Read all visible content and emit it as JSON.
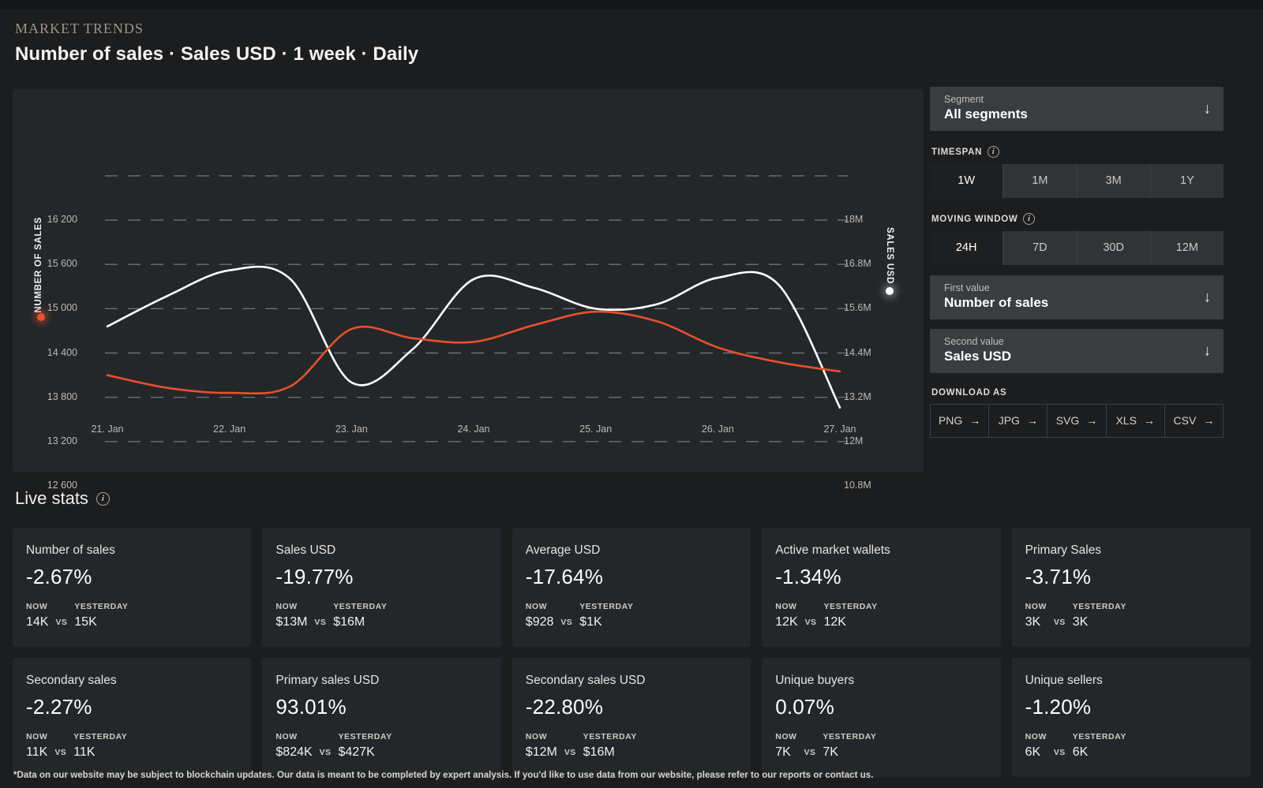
{
  "header": {
    "eyebrow": "MARKET TRENDS",
    "title": "Number of sales · Sales USD · 1 week · Daily"
  },
  "chart_data": {
    "type": "line",
    "title": "Number of sales · Sales USD · 1 week · Daily",
    "xlabel": "",
    "ylabel": "NUMBER OF SALES",
    "y2label": "SALES USD",
    "grid": true,
    "grid_style": "dashed",
    "legend": "none",
    "x_tick_labels": [
      "21. Jan",
      "22. Jan",
      "23. Jan",
      "24. Jan",
      "25. Jan",
      "26. Jan",
      "27. Jan"
    ],
    "y_left_ticks": [
      "12 600",
      "13 200",
      "13 800",
      "14 400",
      "15 000",
      "15 600",
      "16 200"
    ],
    "y_left_values": [
      12600,
      13200,
      13800,
      14400,
      15000,
      15600,
      16200
    ],
    "ylim": [
      12300,
      16500
    ],
    "y_right_ticks": [
      "10.8M",
      "12M",
      "13.2M",
      "14.4M",
      "15.6M",
      "16.8M",
      "18M"
    ],
    "y_right_values": [
      10800000,
      12000000,
      13200000,
      14400000,
      15600000,
      16800000,
      18000000
    ],
    "y2lim": [
      10200000,
      18600000
    ],
    "series": [
      {
        "name": "Number of sales",
        "axis": "left",
        "color": "#ffffff",
        "marker_color": "#ffffff",
        "x": [
          "21. Jan",
          "21. Jan (pm)",
          "22. Jan",
          "22. Jan (pm)",
          "23. Jan",
          "23. Jan (pm)",
          "24. Jan",
          "24. Jan (pm)",
          "25. Jan",
          "25. Jan (pm)",
          "26. Jan",
          "26. Jan (pm)",
          "27. Jan"
        ],
        "values": [
          14760,
          15180,
          15520,
          15400,
          14000,
          14450,
          15400,
          15280,
          15000,
          15060,
          15420,
          15320,
          13660
        ]
      },
      {
        "name": "Sales USD",
        "axis": "right",
        "color": "#e8502e",
        "marker_color": "#e8502e",
        "x": [
          "21. Jan",
          "21. Jan (pm)",
          "22. Jan",
          "22. Jan (pm)",
          "23. Jan",
          "23. Jan (pm)",
          "24. Jan",
          "24. Jan (pm)",
          "25. Jan",
          "25. Jan (pm)",
          "26. Jan",
          "26. Jan (pm)",
          "27. Jan"
        ],
        "values": [
          13800000,
          13450000,
          13320000,
          13500000,
          15050000,
          14800000,
          14700000,
          15160000,
          15520000,
          15260000,
          14550000,
          14150000,
          13900000
        ]
      }
    ]
  },
  "controls": {
    "segment": {
      "label": "Segment",
      "value": "All segments",
      "icon": "chevron-down-icon"
    },
    "timespan": {
      "label": "TIMESPAN",
      "info_icon": "info-icon",
      "options": [
        "1W",
        "1M",
        "3M",
        "1Y"
      ],
      "selected": "1W"
    },
    "moving_window": {
      "label": "MOVING WINDOW",
      "info_icon": "info-icon",
      "options": [
        "24H",
        "7D",
        "30D",
        "12M"
      ],
      "selected": "24H"
    },
    "first_value": {
      "label": "First value",
      "value": "Number of sales",
      "icon": "chevron-down-icon"
    },
    "second_value": {
      "label": "Second value",
      "value": "Sales USD",
      "icon": "chevron-down-icon"
    },
    "download": {
      "label": "DOWNLOAD AS",
      "options": [
        "PNG",
        "JPG",
        "SVG",
        "XLS",
        "CSV"
      ],
      "arrow_icon": "arrow-right-icon"
    }
  },
  "live_stats": {
    "heading": "Live stats",
    "info_icon": "info-icon",
    "now_caption": "NOW",
    "yesterday_caption": "YESTERDAY",
    "vs_caption": "VS",
    "cards": [
      {
        "name": "Number of sales",
        "pct": "-2.67%",
        "now": "14K",
        "yesterday": "15K"
      },
      {
        "name": "Sales USD",
        "pct": "-19.77%",
        "now": "$13M",
        "yesterday": "$16M"
      },
      {
        "name": "Average USD",
        "pct": "-17.64%",
        "now": "$928",
        "yesterday": "$1K"
      },
      {
        "name": "Active market wallets",
        "pct": "-1.34%",
        "now": "12K",
        "yesterday": "12K"
      },
      {
        "name": "Primary Sales",
        "pct": "-3.71%",
        "now": "3K",
        "yesterday": "3K"
      },
      {
        "name": "Secondary sales",
        "pct": "-2.27%",
        "now": "11K",
        "yesterday": "11K"
      },
      {
        "name": "Primary sales USD",
        "pct": "93.01%",
        "now": "$824K",
        "yesterday": "$427K"
      },
      {
        "name": "Secondary sales USD",
        "pct": "-22.80%",
        "now": "$12M",
        "yesterday": "$16M"
      },
      {
        "name": "Unique buyers",
        "pct": "0.07%",
        "now": "7K",
        "yesterday": "7K"
      },
      {
        "name": "Unique sellers",
        "pct": "-1.20%",
        "now": "6K",
        "yesterday": "6K"
      }
    ]
  },
  "footer": {
    "note": "*Data on our website may be subject to blockchain updates. Our data is meant to be completed by expert analysis. If you'd like to use data from our website, please refer to our reports or contact us."
  }
}
